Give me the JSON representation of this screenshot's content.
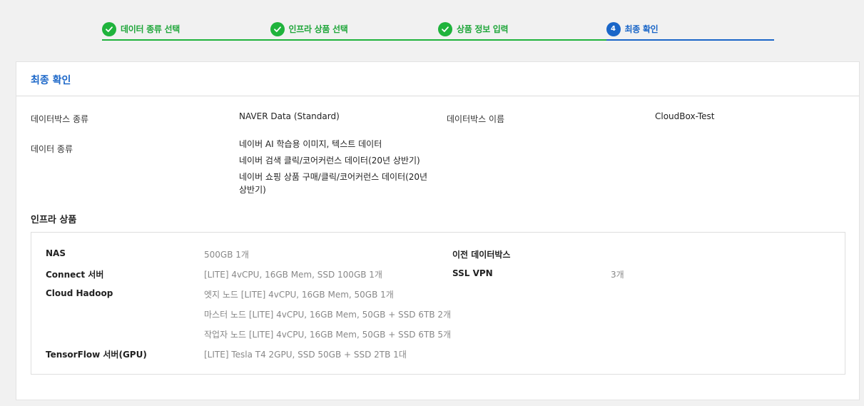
{
  "stepper": {
    "steps": [
      {
        "label": "데이터 종류 선택",
        "status": "done"
      },
      {
        "label": "인프라 상품 선택",
        "status": "done"
      },
      {
        "label": "상품 정보 입력",
        "status": "done"
      },
      {
        "label": "최종 확인",
        "status": "current",
        "number": "4"
      }
    ]
  },
  "card": {
    "title": "최종 확인",
    "fields": {
      "databox_type_label": "데이터박스 종류",
      "databox_type_value": "NAVER Data (Standard)",
      "databox_name_label": "데이터박스 이름",
      "databox_name_value": "CloudBox-Test",
      "data_type_label": "데이터 종류",
      "data_type_values": [
        "네이버 AI 학습용 이미지, 텍스트 데이터",
        "네이버 검색 클릭/코어커런스 데이터(20년 상반기)",
        "네이버 쇼핑 상품 구매/클릭/코어커런스 데이터(20년 상반기)"
      ]
    },
    "infra_title": "인프라 상품",
    "infra": {
      "nas_label": "NAS",
      "nas_value": "500GB 1개",
      "connect_label": "Connect 서버",
      "connect_value": "[LITE] 4vCPU, 16GB Mem, SSD 100GB 1개",
      "hadoop_label": "Cloud Hadoop",
      "hadoop_values": [
        "엣지 노드 [LITE] 4vCPU, 16GB Mem, 50GB 1개",
        "마스터 노드 [LITE] 4vCPU, 16GB Mem, 50GB + SSD 6TB 2개",
        "작업자 노드 [LITE] 4vCPU, 16GB Mem, 50GB + SSD 6TB 5개"
      ],
      "tensorflow_label": "TensorFlow 서버(GPU)",
      "tensorflow_value": "[LITE] Tesla T4 2GPU, SSD 50GB + SSD 2TB 1대",
      "prev_databox_label": "이전 데이터박스",
      "prev_databox_value": "",
      "sslvpn_label": "SSL VPN",
      "sslvpn_value": "3개"
    }
  },
  "colors": {
    "done": "#1fb33c",
    "current": "#1a66c8"
  }
}
